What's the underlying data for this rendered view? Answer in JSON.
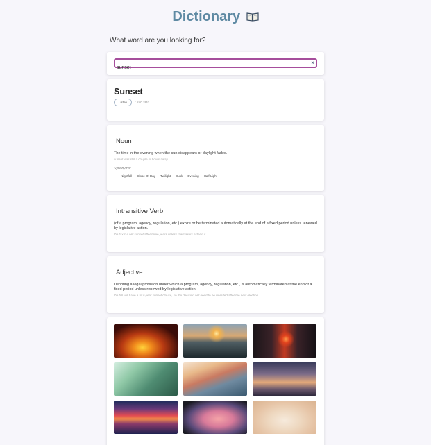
{
  "app": {
    "title": "Dictionary"
  },
  "search": {
    "prompt": "What word are you looking for?",
    "value": "sunset",
    "clear_icon": "×"
  },
  "word": {
    "headword": "Sunset",
    "listen_label": "Listen",
    "phonetic": "/ˈsʌn.sɛt/"
  },
  "meanings": [
    {
      "part_of_speech": "Noun",
      "definition": "The time in the evening when the sun disappears or daylight fades.",
      "example": "sunset was still a couple of hours away",
      "synonyms_label": "Synonyms:",
      "synonyms": [
        "Nightfall",
        "Close Of Day",
        "Twilight",
        "Dusk",
        "Evening",
        "Half-Light"
      ]
    },
    {
      "part_of_speech": "Intransitive Verb",
      "definition": "(of a program, agency, regulation, etc.) expire or be terminated automatically at the end of a fixed period unless renewed by legislative action.",
      "example": "the tax cut will sunset after three years unless lawmakers extend it"
    },
    {
      "part_of_speech": "Adjective",
      "definition": "Denoting a legal provision under which a program, agency, regulation, etc., is automatically terminated at the end of a fixed period unless renewed by legislative action.",
      "example": "the bill will have a four-year sunset clause, so the decision will need to be revisited after the next election"
    }
  ],
  "colors": {
    "title": "#5f8aa3",
    "search_border": "#a64e9c",
    "background": "#f7f6fb"
  },
  "gallery": {
    "images": [
      {
        "name": "sea-cave-sunset-photo"
      },
      {
        "name": "ocean-waves-sunset-photo"
      },
      {
        "name": "city-street-sunset-photo"
      },
      {
        "name": "green-light-rays-photo"
      },
      {
        "name": "coastal-cliff-town-photo"
      },
      {
        "name": "purple-clouds-sky-photo"
      },
      {
        "name": "lake-tree-sunset-photo"
      },
      {
        "name": "airplane-window-sunset-photo"
      },
      {
        "name": "taj-mahal-photo"
      }
    ]
  }
}
